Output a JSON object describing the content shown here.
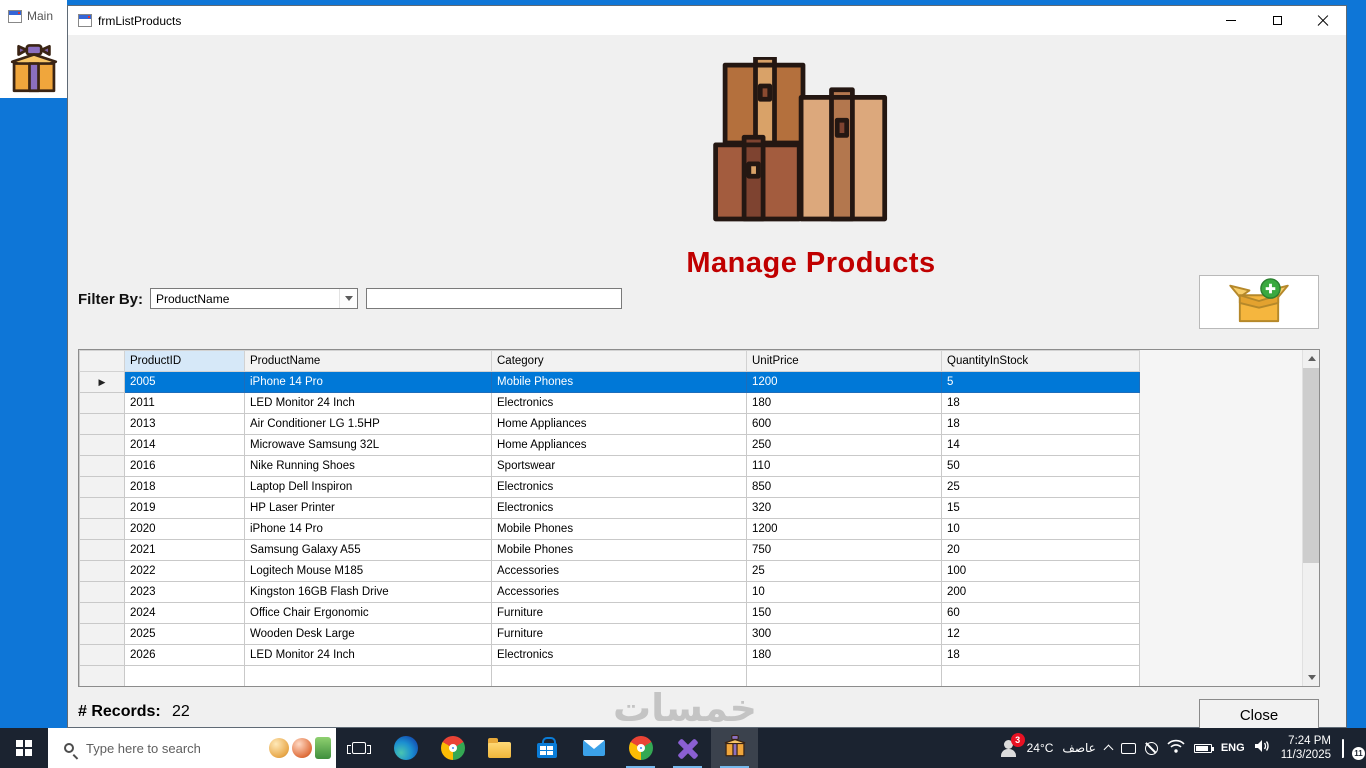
{
  "colors": {
    "accent": "#0078d7",
    "heading": "#c00000",
    "selection": "#0078d7",
    "taskbar": "#1b2330",
    "desktop": "#0e76d7"
  },
  "desktop": {
    "background_window_title": "Main"
  },
  "window": {
    "title": "frmListProducts"
  },
  "header": {
    "title": "Manage Products"
  },
  "filter": {
    "label": "Filter By:",
    "selected_option": "ProductName",
    "input_value": ""
  },
  "grid": {
    "columns": [
      "ProductID",
      "ProductName",
      "Category",
      "UnitPrice",
      "QuantityInStock"
    ],
    "selected_index": 0,
    "rows": [
      [
        "2005",
        "iPhone 14 Pro",
        "Mobile Phones",
        "1200",
        "5"
      ],
      [
        "2011",
        "LED Monitor 24 Inch",
        "Electronics",
        "180",
        "18"
      ],
      [
        "2013",
        "Air Conditioner LG 1.5HP",
        "Home Appliances",
        "600",
        "18"
      ],
      [
        "2014",
        "Microwave Samsung 32L",
        "Home Appliances",
        "250",
        "14"
      ],
      [
        "2016",
        "Nike Running Shoes",
        "Sportswear",
        "110",
        "50"
      ],
      [
        "2018",
        "Laptop Dell Inspiron",
        "Electronics",
        "850",
        "25"
      ],
      [
        "2019",
        "HP Laser Printer",
        "Electronics",
        "320",
        "15"
      ],
      [
        "2020",
        "iPhone 14 Pro",
        "Mobile Phones",
        "1200",
        "10"
      ],
      [
        "2021",
        "Samsung Galaxy A55",
        "Mobile Phones",
        "750",
        "20"
      ],
      [
        "2022",
        "Logitech Mouse M185",
        "Accessories",
        "25",
        "100"
      ],
      [
        "2023",
        "Kingston 16GB Flash Drive",
        "Accessories",
        "10",
        "200"
      ],
      [
        "2024",
        "Office Chair Ergonomic",
        "Furniture",
        "150",
        "60"
      ],
      [
        "2025",
        "Wooden Desk Large",
        "Furniture",
        "300",
        "12"
      ],
      [
        "2026",
        "LED Monitor 24 Inch",
        "Electronics",
        "180",
        "18"
      ]
    ]
  },
  "footer": {
    "records_label": "# Records:",
    "records_count": "22",
    "close_label": "Close"
  },
  "watermark": "خمسات",
  "taskbar": {
    "search_placeholder": "Type here to search",
    "tray": {
      "people_badge": "3",
      "temperature": "24°C",
      "weather": "عاصف",
      "language": "ENG",
      "time": "7:24 PM",
      "date": "11/3/2025",
      "notification_count": "11"
    }
  }
}
